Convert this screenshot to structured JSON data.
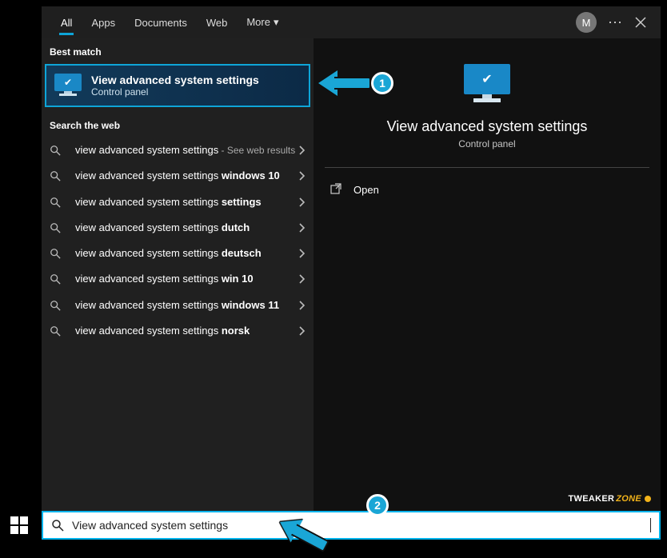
{
  "tabs": {
    "all": "All",
    "apps": "Apps",
    "documents": "Documents",
    "web": "Web",
    "more": "More"
  },
  "avatar_initial": "M",
  "left": {
    "best_match_label": "Best match",
    "best_match": {
      "title": "View advanced system settings",
      "subtitle": "Control panel"
    },
    "search_web_label": "Search the web",
    "results": [
      {
        "base": "view advanced system settings",
        "bold": "",
        "suffix": " - See web results"
      },
      {
        "base": "view advanced system settings ",
        "bold": "windows 10",
        "suffix": ""
      },
      {
        "base": "view advanced system settings ",
        "bold": "settings",
        "suffix": ""
      },
      {
        "base": "view advanced system settings ",
        "bold": "dutch",
        "suffix": ""
      },
      {
        "base": "view advanced system settings ",
        "bold": "deutsch",
        "suffix": ""
      },
      {
        "base": "view advanced system settings ",
        "bold": "win 10",
        "suffix": ""
      },
      {
        "base": "view advanced system settings ",
        "bold": "windows 11",
        "suffix": ""
      },
      {
        "base": "view advanced system settings ",
        "bold": "norsk",
        "suffix": ""
      }
    ]
  },
  "right": {
    "title": "View advanced system settings",
    "subtitle": "Control panel",
    "open_label": "Open"
  },
  "watermark": {
    "part1": "TWEAKER",
    "part2": "ZONE"
  },
  "search": {
    "value": "View advanced system settings"
  },
  "annotations": {
    "one": "1",
    "two": "2"
  }
}
